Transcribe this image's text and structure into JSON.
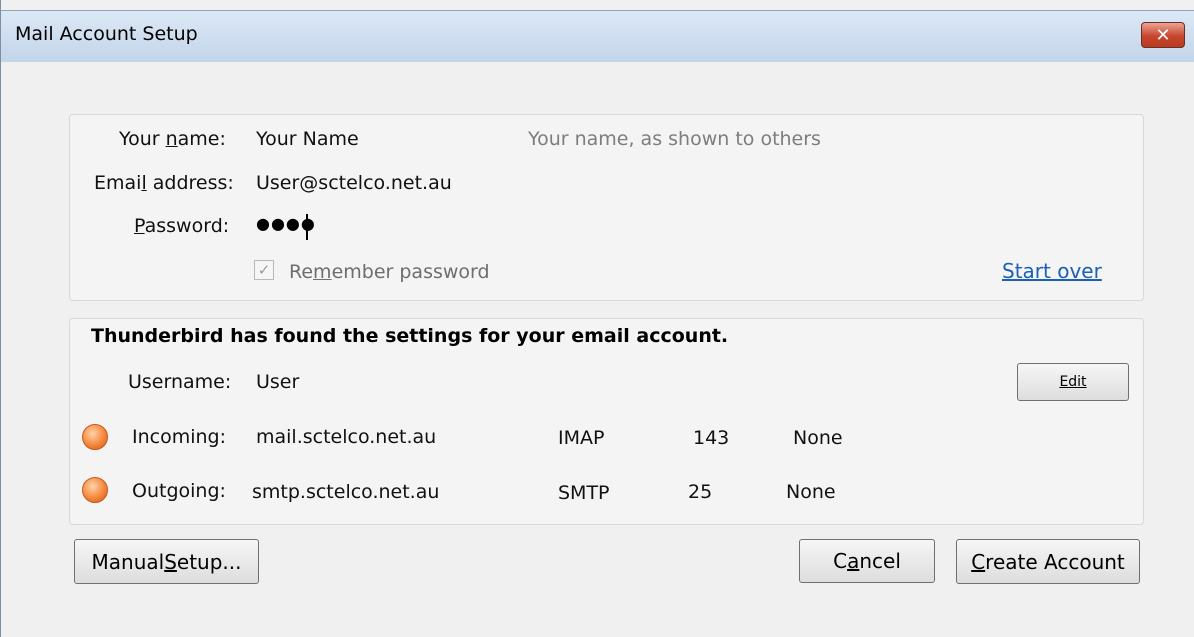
{
  "window": {
    "title": "Mail Account Setup",
    "close_symbol": "✕"
  },
  "identity": {
    "name_label_pre": "Your ",
    "name_label_key": "n",
    "name_label_post": "ame:",
    "name_value": "Your Name",
    "name_hint": "Your name, as shown to others",
    "email_label_pre": "Emai",
    "email_label_key": "l",
    "email_label_post": " address:",
    "email_value": "User@sctelco.net.au",
    "password_label_key": "P",
    "password_label_post": "assword:",
    "password_value": "●●●●",
    "remember_pre": "Re",
    "remember_key": "m",
    "remember_post": "ember password",
    "remember_checked": true,
    "start_over": "Start over"
  },
  "settings": {
    "heading": "Thunderbird has found the settings for your email account.",
    "username_label": "Username:",
    "username_value": "User",
    "edit_label": "Edit",
    "incoming": {
      "label": "Incoming:",
      "server": "mail.sctelco.net.au",
      "protocol": "IMAP",
      "port": "143",
      "security": "None",
      "status_color": "#f5873c"
    },
    "outgoing": {
      "label": "Outgoing:",
      "server": "smtp.sctelco.net.au",
      "protocol": "SMTP",
      "port": "25",
      "security": "None",
      "status_color": "#f5873c"
    }
  },
  "footer": {
    "manual_pre": "Manual ",
    "manual_key": "S",
    "manual_post": "etup...",
    "cancel_pre": "C",
    "cancel_key": "a",
    "cancel_post": "ncel",
    "create_key": "C",
    "create_post": "reate Account"
  },
  "colors": {
    "link": "#1c5fb8",
    "hint": "#7d7d7d",
    "close": "#c7452c"
  }
}
